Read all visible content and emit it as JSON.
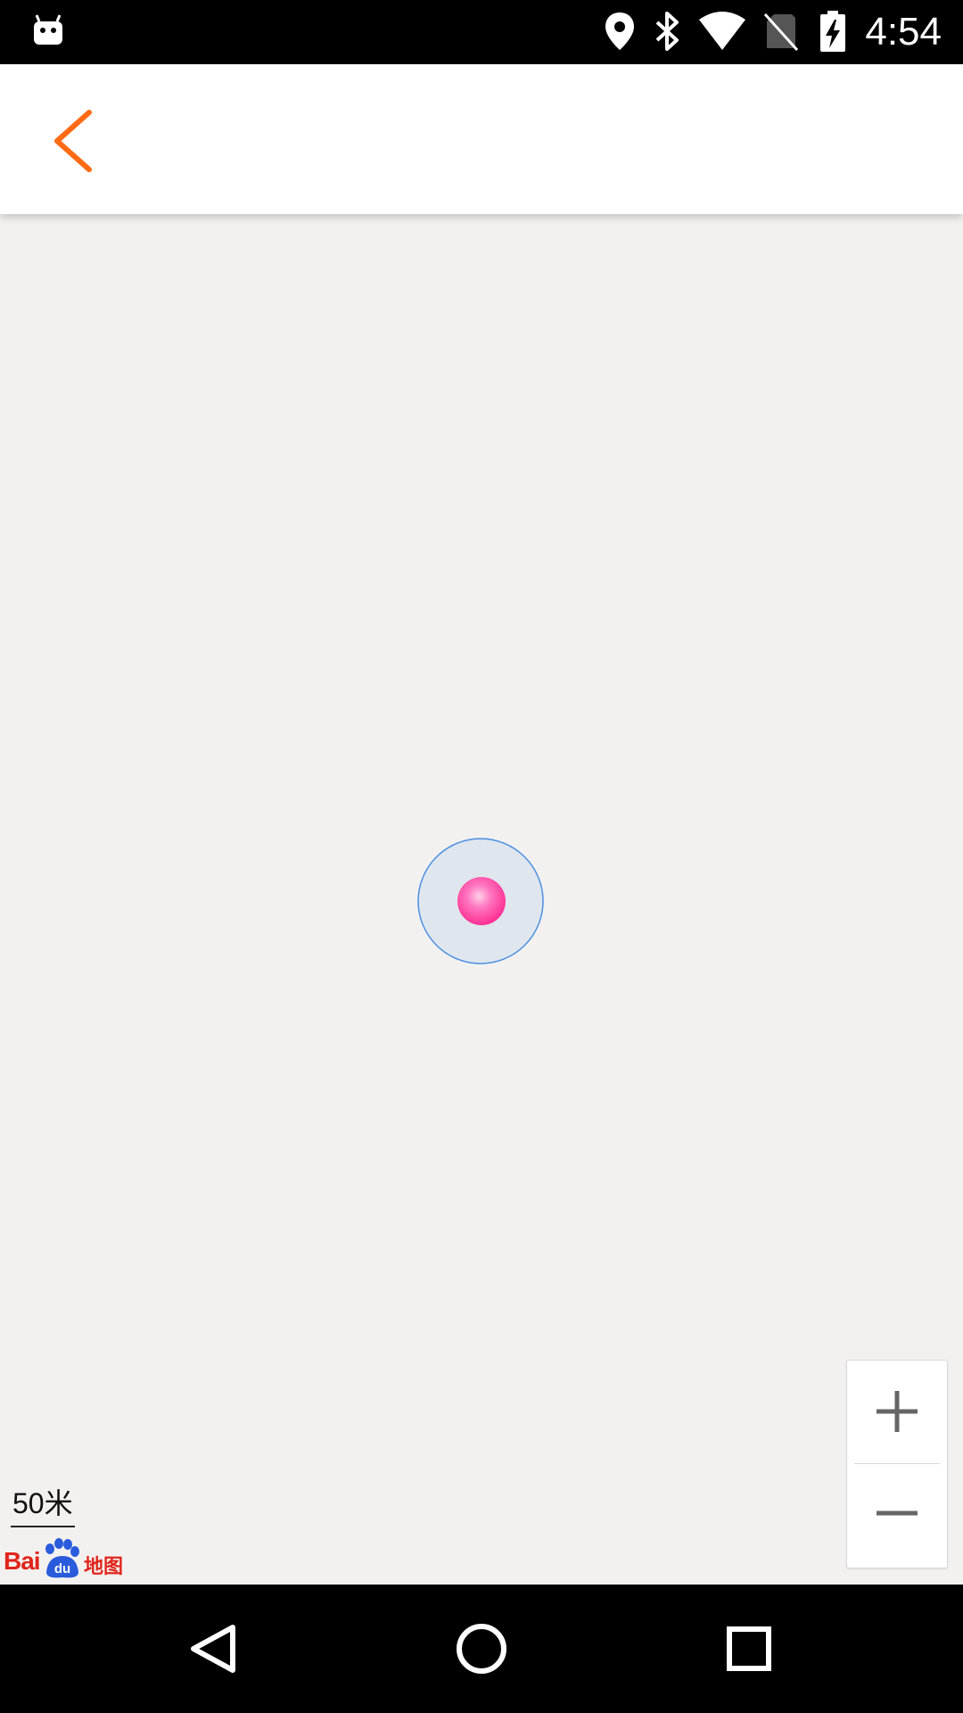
{
  "status_bar": {
    "time": "4:54",
    "icons": [
      "android-notification-icon",
      "location-pin-icon",
      "bluetooth-icon",
      "wifi-icon",
      "no-sim-icon",
      "battery-charging-icon"
    ]
  },
  "toolbar": {
    "back_icon": "chevron-left-icon",
    "accent_color": "#ff6a13"
  },
  "map": {
    "background_color": "#f3f1f0",
    "scale_label": "50米",
    "logo": {
      "bai": "Bai",
      "du": "du",
      "ditu": "地图"
    },
    "zoom_in_icon": "plus-icon",
    "zoom_out_icon": "minus-icon",
    "marker_color": "#ff4aa0",
    "accuracy_ring_color": "#4a90e2"
  },
  "nav_bar": {
    "back_icon": "triangle-back-icon",
    "home_icon": "circle-home-icon",
    "recents_icon": "square-recents-icon"
  }
}
